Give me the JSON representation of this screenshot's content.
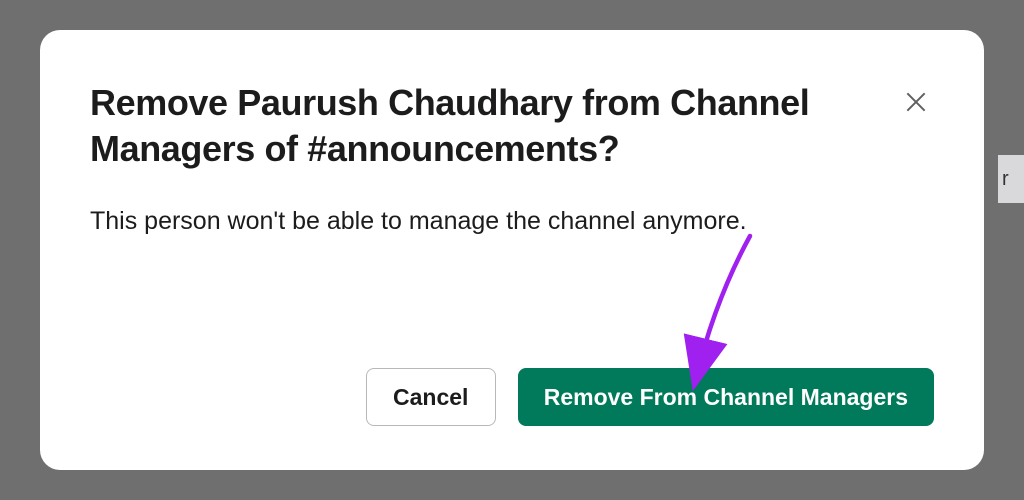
{
  "dialog": {
    "title": "Remove Paurush Chaudhary from Channel Managers of #announcements?",
    "body": "This person won't be able to manage the channel anymore.",
    "cancel_label": "Cancel",
    "confirm_label": "Remove From Channel Managers"
  },
  "background": {
    "hint": "r"
  },
  "colors": {
    "confirm_bg": "#007a5a",
    "arrow": "#a020f0"
  }
}
